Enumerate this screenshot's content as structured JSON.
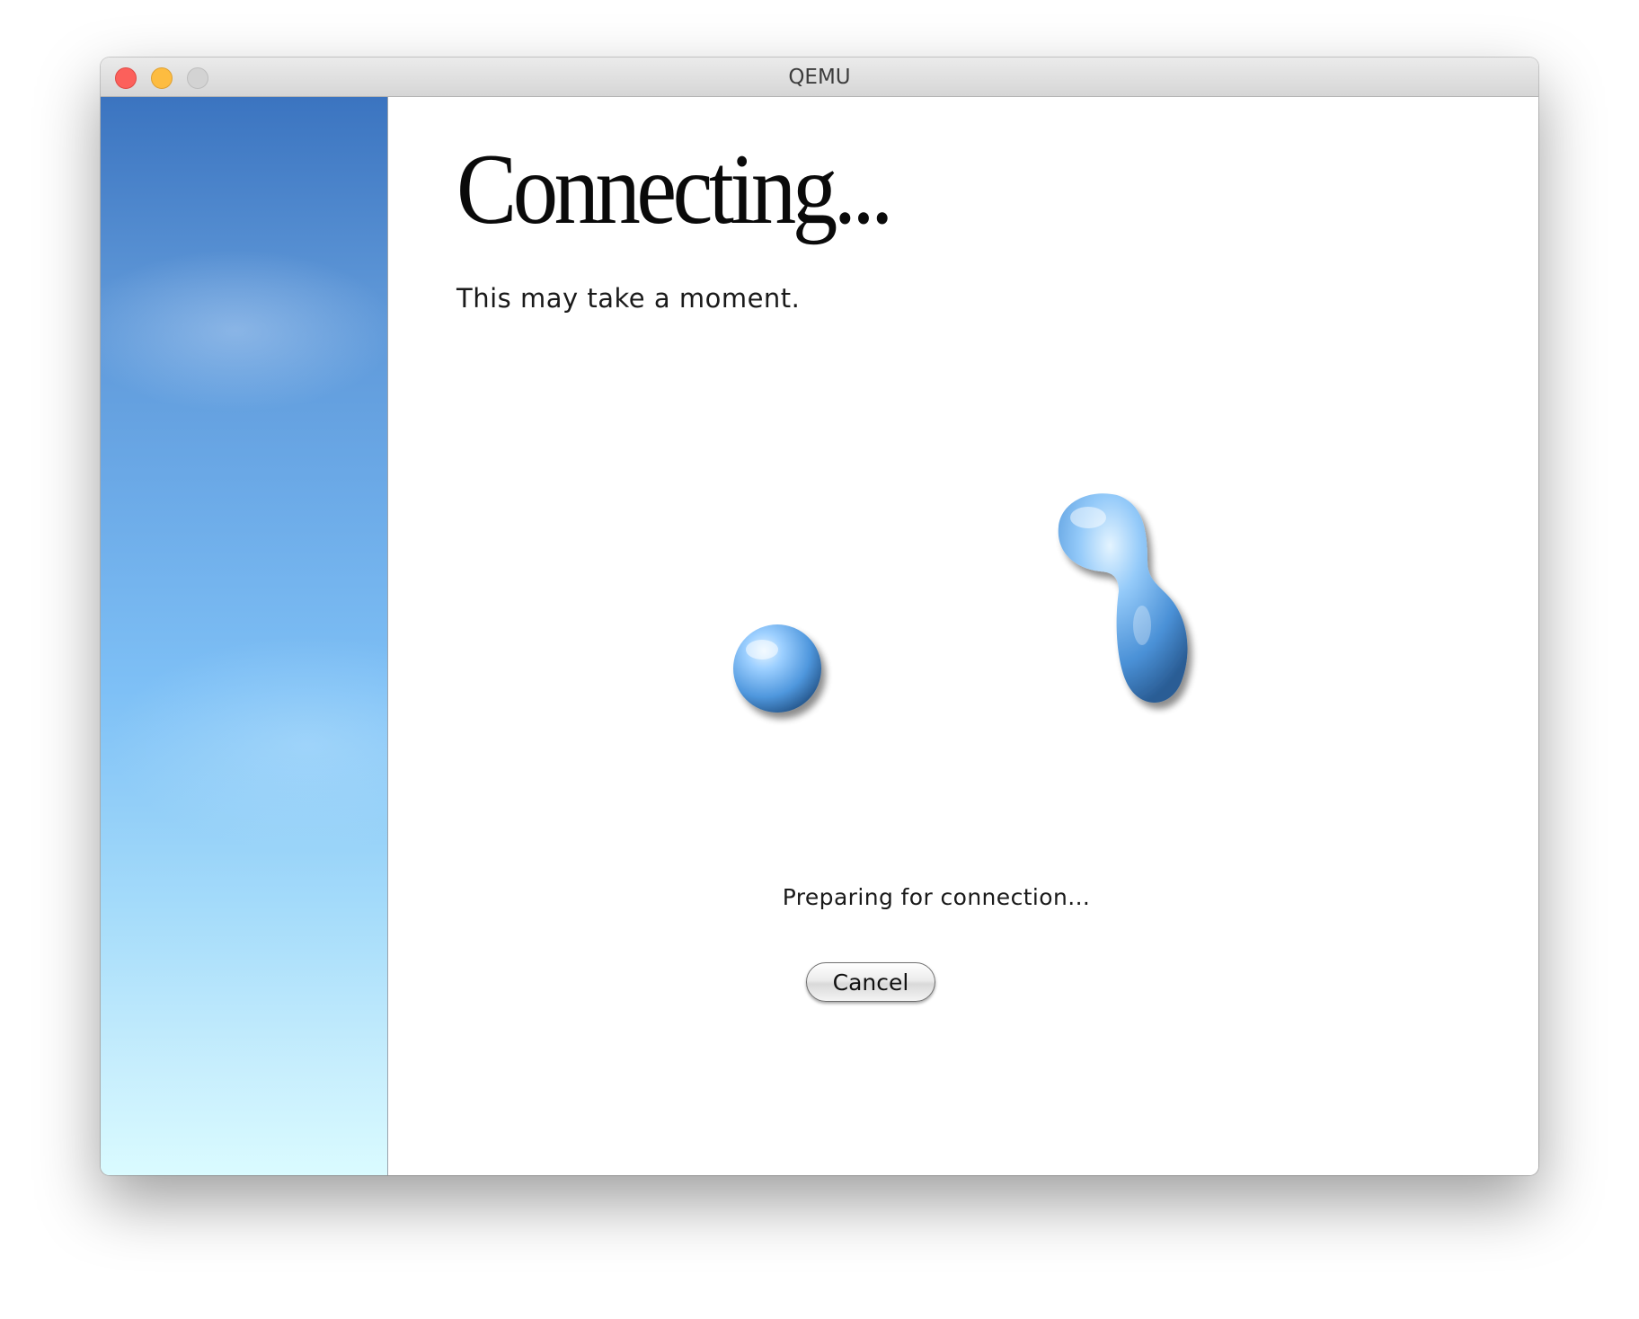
{
  "window": {
    "title": "QEMU",
    "controls": [
      "close-icon",
      "minimize-icon",
      "zoom-icon"
    ]
  },
  "main": {
    "heading": "Connecting...",
    "subheading": "This may take a moment.",
    "status": "Preparing for connection...",
    "cancel_label": "Cancel",
    "animation": {
      "icons": [
        "droplet-icon",
        "splitting-droplet-icon"
      ],
      "color": "#5aa3e6"
    }
  },
  "sidebar": {
    "colors": [
      "#3b74c0",
      "#7ec0f6",
      "#dafbff"
    ]
  },
  "cursor": {
    "icon": "arrow-cursor-icon"
  }
}
